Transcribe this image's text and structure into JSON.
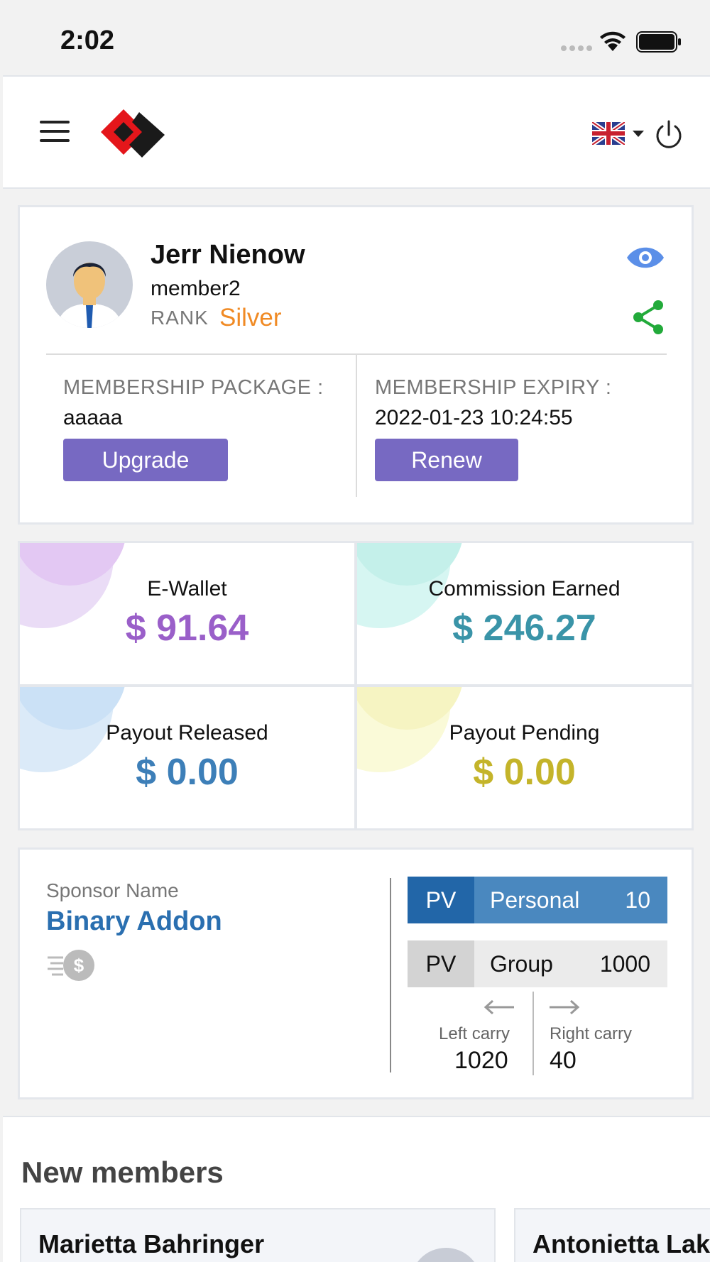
{
  "status_bar": {
    "time": "2:02"
  },
  "header": {
    "menu_icon": "hamburger-menu-icon",
    "language_icon": "uk-flag-icon",
    "power_icon": "power-icon"
  },
  "profile": {
    "name": "Jerr Nienow",
    "username": "member2",
    "rank_label": "RANK",
    "rank": "Silver",
    "rank_color": "#f08a24",
    "membership_package_label": "MEMBERSHIP PACKAGE :",
    "membership_package": "aaaaa",
    "upgrade_label": "Upgrade",
    "membership_expiry_label": "MEMBERSHIP EXPIRY :",
    "membership_expiry": "2022-01-23 10:24:55",
    "renew_label": "Renew",
    "button_color": "#7769c2"
  },
  "stats": [
    {
      "label": "E-Wallet",
      "value": "$ 91.64",
      "color": "#9a5fc9"
    },
    {
      "label": "Commission Earned",
      "value": "$ 246.27",
      "color": "#3a94a8"
    },
    {
      "label": "Payout Released",
      "value": "$ 0.00",
      "color": "#3d7fb8"
    },
    {
      "label": "Payout Pending",
      "value": "$ 0.00",
      "color": "#c4b42a"
    }
  ],
  "sponsor": {
    "label": "Sponsor Name",
    "name": "Binary Addon",
    "pv_personal": {
      "tag": "PV",
      "label": "Personal",
      "value": "10"
    },
    "pv_group": {
      "tag": "PV",
      "label": "Group",
      "value": "1000"
    },
    "left_carry_label": "Left carry",
    "left_carry": "1020",
    "right_carry_label": "Right carry",
    "right_carry": "40"
  },
  "new_members": {
    "title": "New members",
    "members": [
      {
        "name": "Marietta Bahringer"
      },
      {
        "name": "Antonietta Lak"
      }
    ]
  }
}
